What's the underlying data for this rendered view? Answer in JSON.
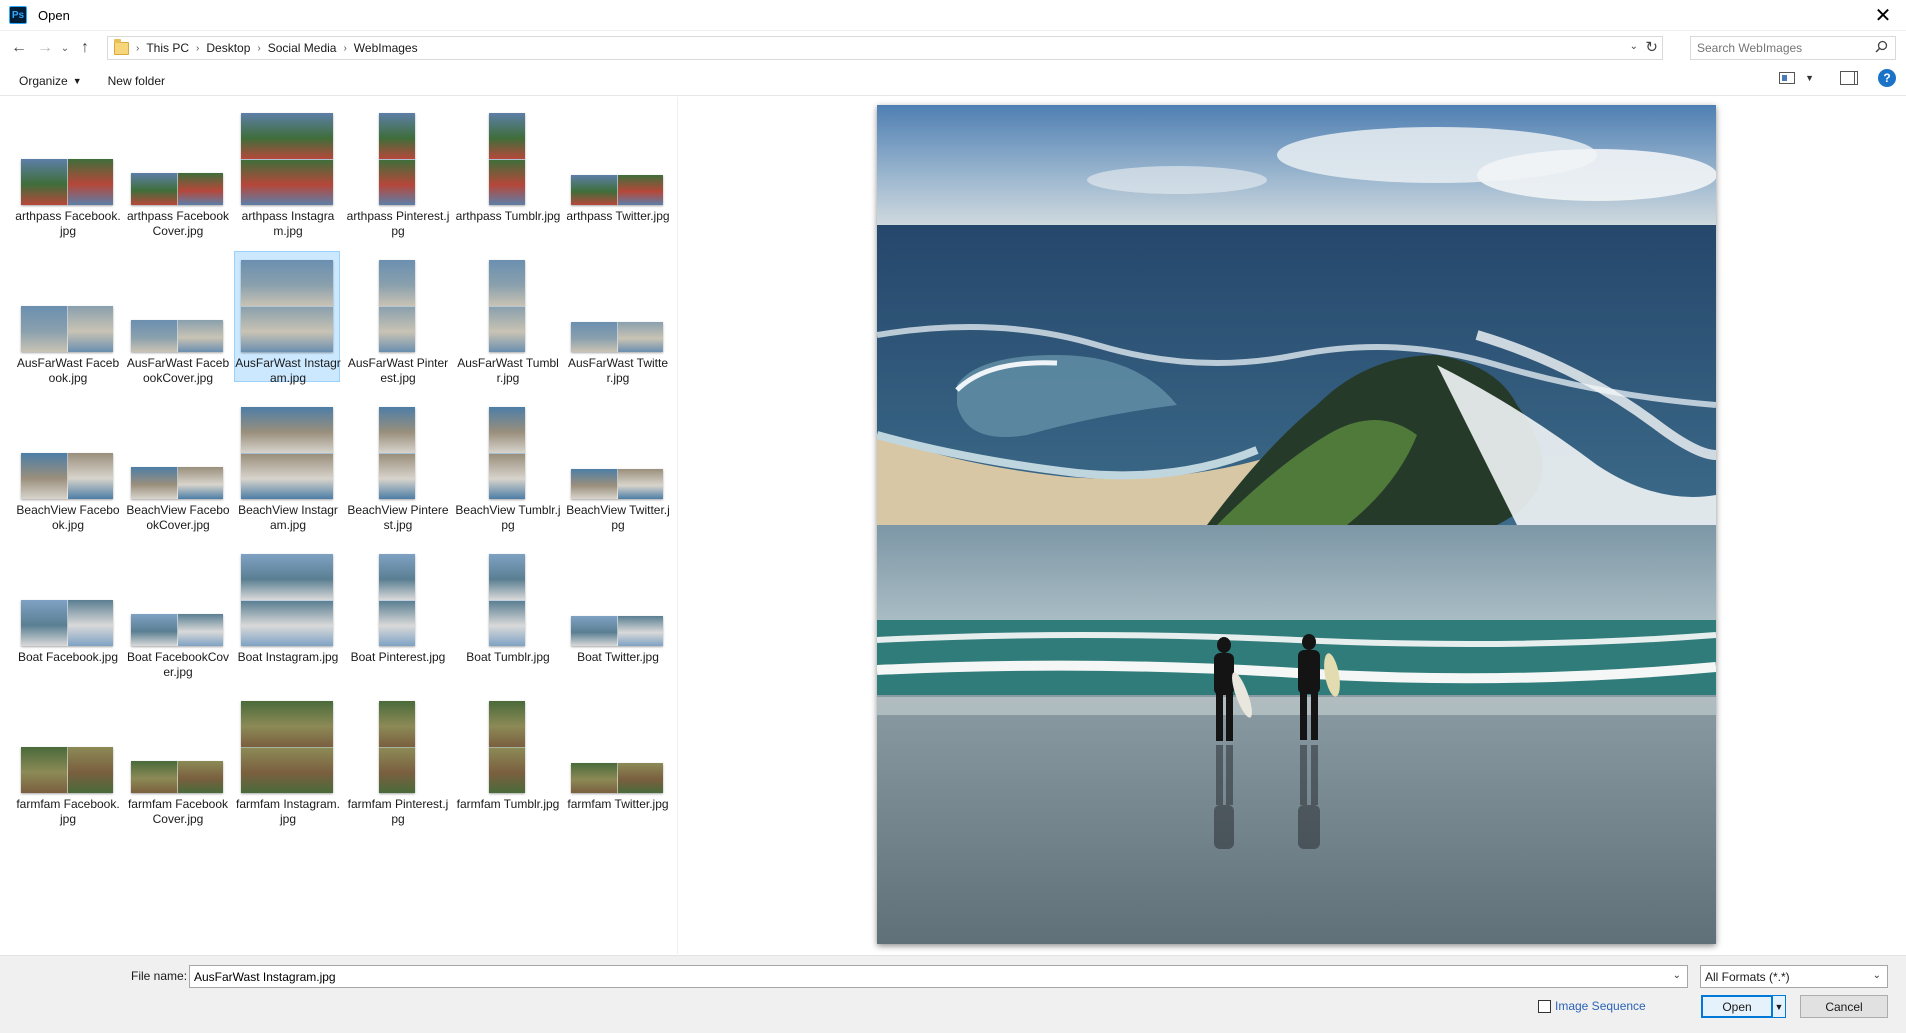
{
  "window": {
    "title": "Open",
    "app_icon_text": "Ps"
  },
  "address": {
    "crumbs": [
      "This PC",
      "Desktop",
      "Social Media",
      "WebImages"
    ]
  },
  "search": {
    "placeholder": "Search WebImages"
  },
  "toolbar": {
    "organize_label": "Organize",
    "new_folder_label": "New folder"
  },
  "files": [
    {
      "kind": "fb",
      "theme": "arthpass",
      "label": "arthpass Facebook.jpg"
    },
    {
      "kind": "fbc",
      "theme": "arthpass",
      "label": "arthpass FacebookCover.jpg"
    },
    {
      "kind": "ig",
      "theme": "arthpass",
      "label": "arthpass Instagram.jpg"
    },
    {
      "kind": "pin",
      "theme": "arthpass",
      "label": "arthpass Pinterest.jpg"
    },
    {
      "kind": "pin",
      "theme": "arthpass",
      "label": "arthpass Tumblr.jpg"
    },
    {
      "kind": "tw",
      "theme": "arthpass",
      "label": "arthpass Twitter.jpg"
    },
    {
      "kind": "fb",
      "theme": "ausfar",
      "label": "AusFarWast Facebook.jpg"
    },
    {
      "kind": "fbc",
      "theme": "ausfar",
      "label": "AusFarWast FacebookCover.jpg"
    },
    {
      "kind": "ig",
      "theme": "ausfar",
      "label": "AusFarWast Instagram.jpg",
      "selected": true
    },
    {
      "kind": "pin",
      "theme": "ausfar",
      "label": "AusFarWast Pinterest.jpg"
    },
    {
      "kind": "pin",
      "theme": "ausfar",
      "label": "AusFarWast Tumblr.jpg"
    },
    {
      "kind": "tw",
      "theme": "ausfar",
      "label": "AusFarWast Twitter.jpg"
    },
    {
      "kind": "fb",
      "theme": "beach",
      "label": "BeachView Facebook.jpg"
    },
    {
      "kind": "fbc",
      "theme": "beach",
      "label": "BeachView FacebookCover.jpg"
    },
    {
      "kind": "ig",
      "theme": "beach",
      "label": "BeachView Instagram.jpg"
    },
    {
      "kind": "pin",
      "theme": "beach",
      "label": "BeachView Pinterest.jpg"
    },
    {
      "kind": "pin",
      "theme": "beach",
      "label": "BeachView Tumblr.jpg"
    },
    {
      "kind": "tw",
      "theme": "beach",
      "label": "BeachView Twitter.jpg"
    },
    {
      "kind": "fb",
      "theme": "boat",
      "label": "Boat Facebook.jpg"
    },
    {
      "kind": "fbc",
      "theme": "boat",
      "label": "Boat FacebookCover.jpg"
    },
    {
      "kind": "ig",
      "theme": "boat",
      "label": "Boat Instagram.jpg"
    },
    {
      "kind": "pin",
      "theme": "boat",
      "label": "Boat Pinterest.jpg"
    },
    {
      "kind": "pin",
      "theme": "boat",
      "label": "Boat Tumblr.jpg"
    },
    {
      "kind": "tw",
      "theme": "boat",
      "label": "Boat Twitter.jpg"
    },
    {
      "kind": "fb",
      "theme": "farm",
      "label": "farmfam Facebook.jpg"
    },
    {
      "kind": "fbc",
      "theme": "farm",
      "label": "farmfam FacebookCover.jpg"
    },
    {
      "kind": "ig",
      "theme": "farm",
      "label": "farmfam Instagram.jpg"
    },
    {
      "kind": "pin",
      "theme": "farm",
      "label": "farmfam Pinterest.jpg"
    },
    {
      "kind": "pin",
      "theme": "farm",
      "label": "farmfam Tumblr.jpg"
    },
    {
      "kind": "tw",
      "theme": "farm",
      "label": "farmfam Twitter.jpg"
    }
  ],
  "themes": {
    "arthpass": [
      "#5d7fa8",
      "#3f6e3a",
      "#b6473a"
    ],
    "ausfar": [
      "#6b8fb0",
      "#8aa0ad",
      "#c9c3b4"
    ],
    "beach": [
      "#4d7ea6",
      "#9a8f7c",
      "#d8d4cc"
    ],
    "boat": [
      "#7fa2c4",
      "#5a7f92",
      "#d9d9d9"
    ],
    "farm": [
      "#4a6a3a",
      "#8c8a56",
      "#7a5f3f"
    ]
  },
  "bottom": {
    "file_name_label": "File name:",
    "file_name_value": "AusFarWast Instagram.jpg",
    "format_value": "All Formats (*.*)",
    "image_sequence_label": "Image Sequence",
    "open_label": "Open",
    "cancel_label": "Cancel"
  },
  "icons": {
    "close": "close-icon",
    "back": "back-arrow-icon",
    "forward": "forward-arrow-icon",
    "up": "up-arrow-icon",
    "refresh": "refresh-icon",
    "search": "search-icon",
    "help": "help-icon"
  },
  "colors": {
    "selection_bg": "#cce8ff",
    "selection_border": "#99d1ff",
    "accent": "#0078d7"
  }
}
